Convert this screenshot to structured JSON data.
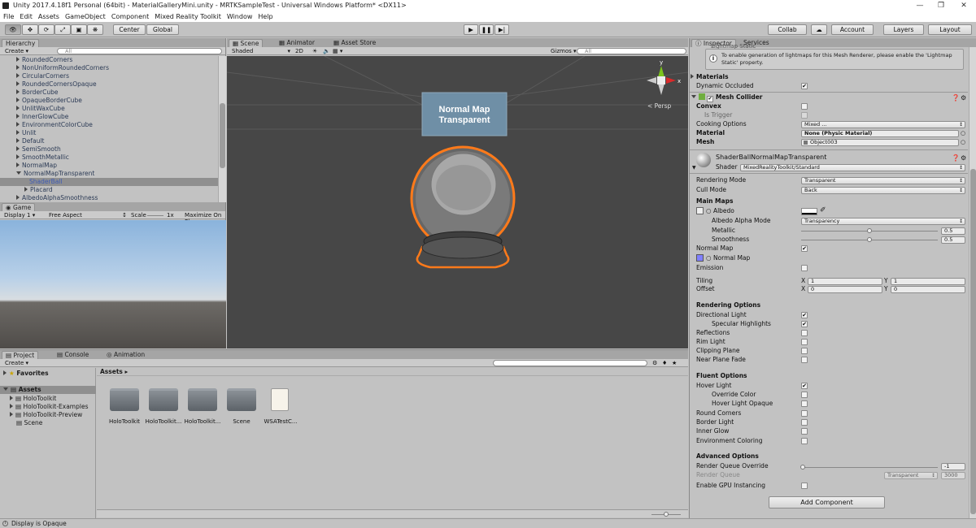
{
  "window": {
    "title": "Unity 2017.4.18f1 Personal (64bit) - MaterialGalleryMini.unity - MRTKSampleTest - Universal Windows Platform* <DX11>"
  },
  "menu": [
    "File",
    "Edit",
    "Assets",
    "GameObject",
    "Component",
    "Mixed Reality Toolkit",
    "Window",
    "Help"
  ],
  "toolbar": {
    "pivot": "Center",
    "space": "Global",
    "collab": "Collab",
    "account": "Account",
    "layers": "Layers",
    "layout": "Layout"
  },
  "hierarchy": {
    "tab": "Hierarchy",
    "create": "Create",
    "search": "All",
    "items": [
      "RoundedCorners",
      "NonUniformRoundedCorners",
      "CircularCorners",
      "RoundedCornersOpaque",
      "BorderCube",
      "OpaqueBorderCube",
      "UnlitWaxCube",
      "InnerGlowCube",
      "EnvironmentColorCube",
      "Unlit",
      "Default",
      "SemiSmooth",
      "SmoothMetallic",
      "NormalMap",
      "NormalMapTransparent",
      "ShaderBall",
      "Placard",
      "AlbedoAlphaSmoothness"
    ]
  },
  "game": {
    "tab": "Game",
    "display": "Display 1",
    "aspect": "Free Aspect",
    "scale_label": "Scale",
    "scale_value": "1x",
    "maximize": "Maximize On Pl"
  },
  "scene": {
    "tabs": [
      "Scene",
      "Animator",
      "Asset Store"
    ],
    "shading": "Shaded",
    "mode2d": "2D",
    "gizmos": "Gizmos",
    "search": "All",
    "persp": "Persp",
    "placard_text": "Normal Map\nTransparent",
    "gizmo_axes": [
      "y",
      "x",
      "z"
    ]
  },
  "project": {
    "tabs": [
      "Project",
      "Console",
      "Animation"
    ],
    "create": "Create",
    "favorites": "Favorites",
    "assets_root": "Assets",
    "tree": [
      "HoloToolkit",
      "HoloToolkit-Examples",
      "HoloToolkit-Preview",
      "Scene"
    ],
    "breadcrumb": "Assets",
    "items": [
      "HoloToolkit",
      "HoloToolkit...",
      "HoloToolkit...",
      "Scene",
      "WSATestC..."
    ]
  },
  "inspector": {
    "tabs": [
      "Inspector",
      "Services"
    ],
    "lightmap_static": "Lightmap Static",
    "lightmap_note": "To enable generation of lightmaps for this Mesh Renderer, please enable the 'Lightmap Static' property.",
    "materials": "Materials",
    "dynamic_occluded": "Dynamic Occluded",
    "mesh_collider": {
      "title": "Mesh Collider",
      "convex": "Convex",
      "is_trigger": "Is Trigger",
      "cooking": "Cooking Options",
      "cooking_value": "Mixed ...",
      "material": "Material",
      "material_value": "None (Physic Material)",
      "mesh": "Mesh",
      "mesh_value": "Object003"
    },
    "material_header": {
      "name": "ShaderBallNormalMapTransparent",
      "shader_label": "Shader",
      "shader_value": "MixedRealityToolkit/Standard"
    },
    "rendering_mode": "Rendering Mode",
    "rendering_mode_value": "Transparent",
    "cull_mode": "Cull Mode",
    "cull_mode_value": "Back",
    "main_maps": "Main Maps",
    "albedo": "Albedo",
    "albedo_alpha_mode": "Albedo Alpha Mode",
    "albedo_alpha_mode_value": "Transparency",
    "metallic": "Metallic",
    "metallic_value": "0.5",
    "smoothness": "Smoothness",
    "smoothness_value": "0.5",
    "normal_map": "Normal Map",
    "normal_map_tex": "Normal Map",
    "emission": "Emission",
    "tiling": "Tiling",
    "offset": "Offset",
    "axis_x": "X",
    "axis_y": "Y",
    "tiling_x": "1",
    "tiling_y": "1",
    "offset_x": "0",
    "offset_y": "0",
    "rendering_options": "Rendering Options",
    "directional_light": "Directional Light",
    "specular_highlights": "Specular Highlights",
    "reflections": "Reflections",
    "rim_light": "Rim Light",
    "clipping_plane": "Clipping Plane",
    "near_plane_fade": "Near Plane Fade",
    "fluent_options": "Fluent Options",
    "hover_light": "Hover Light",
    "override_color": "Override Color",
    "hover_light_opaque": "Hover Light Opaque",
    "round_corners": "Round Corners",
    "border_light": "Border Light",
    "inner_glow": "Inner Glow",
    "environment_coloring": "Environment Coloring",
    "advanced_options": "Advanced Options",
    "rq_override": "Render Queue Override",
    "rq_override_value": "-1",
    "render_queue": "Render Queue",
    "render_queue_mode": "Transparent",
    "render_queue_value": "3000",
    "gpu_instancing": "Enable GPU Instancing",
    "add_component": "Add Component"
  },
  "status": {
    "text": "Display is Opaque"
  },
  "colors": {
    "accent_selection": "#8f8f8f",
    "sky_top": "#8fb6dc",
    "ground": "#5a5753",
    "scene_bg": "#474747",
    "outline": "#ff7a1a",
    "placard": "#6f8fa6",
    "normal_swatch": "#8080ff"
  }
}
